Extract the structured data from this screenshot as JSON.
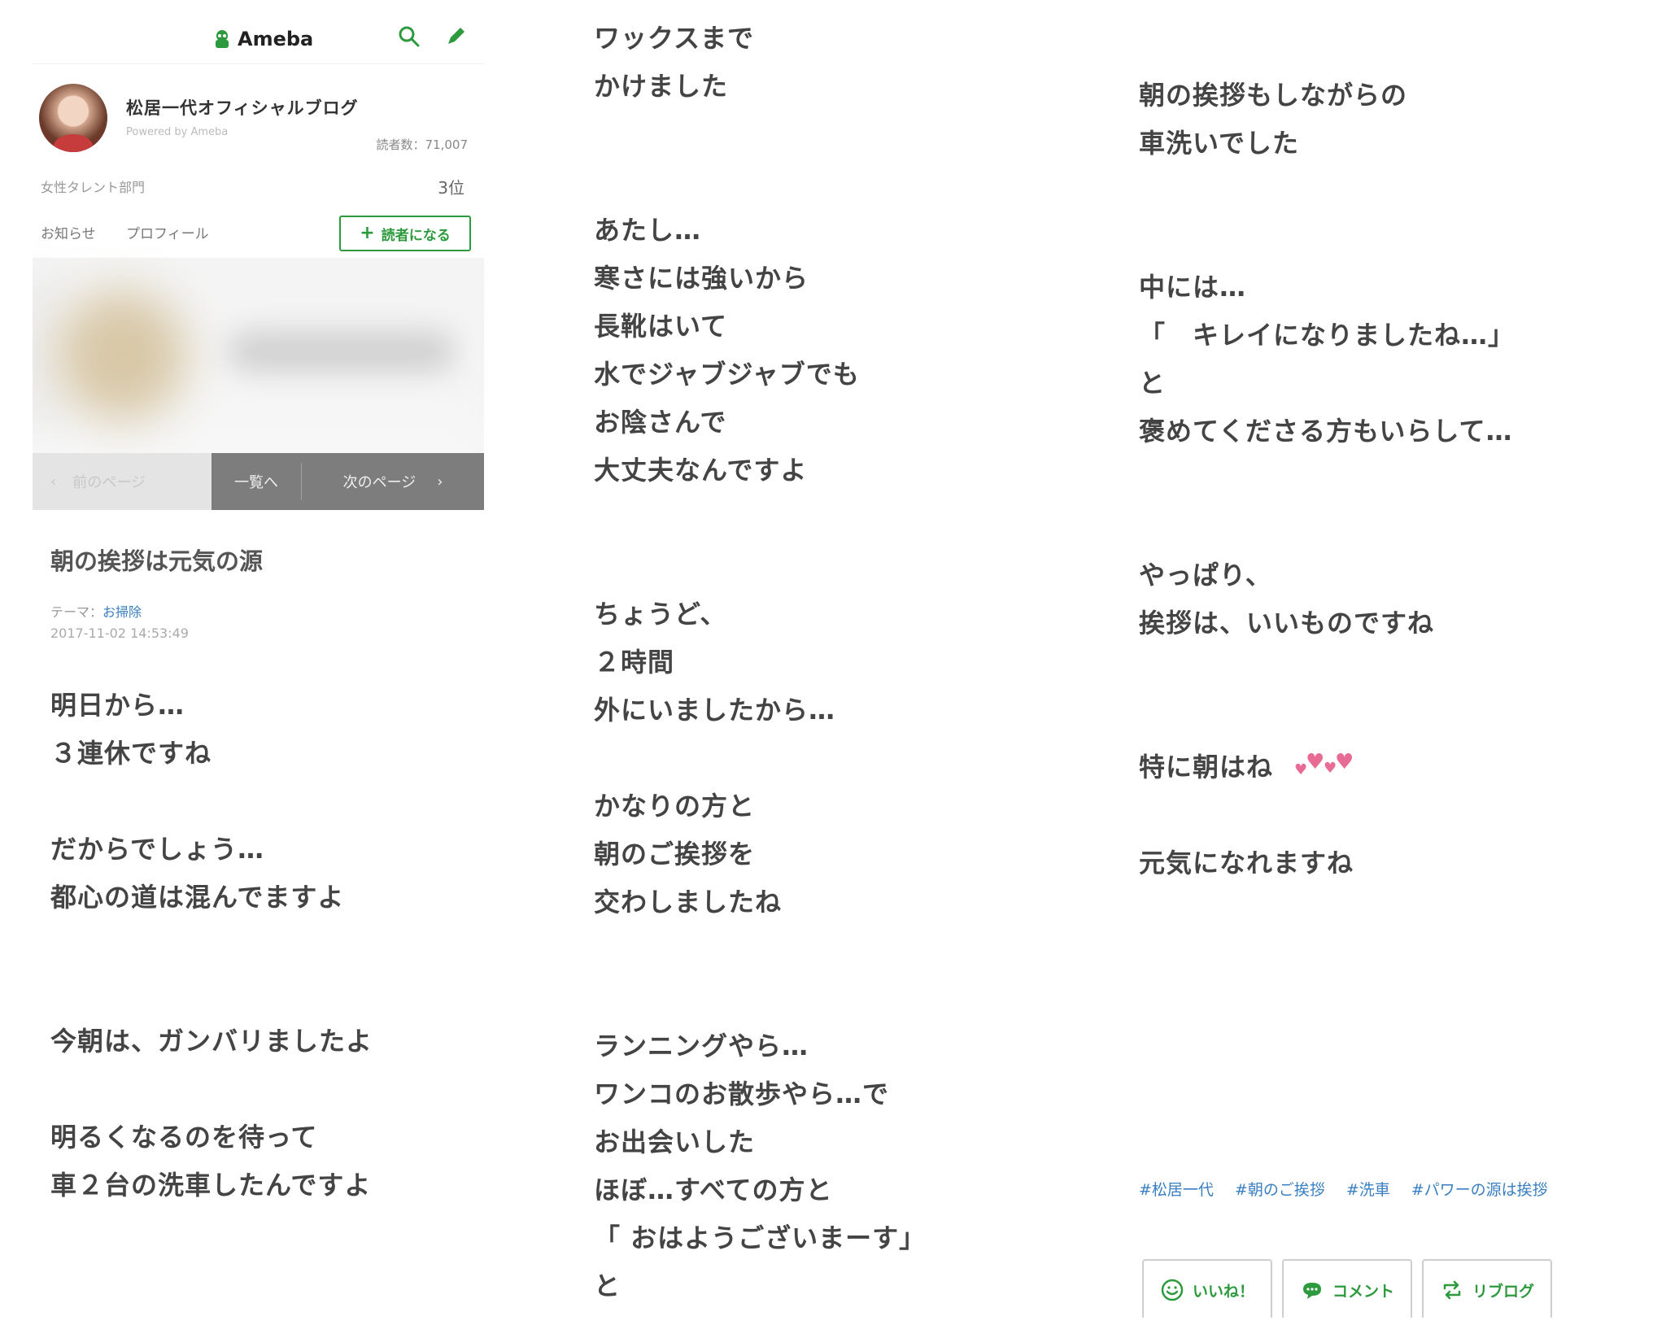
{
  "header": {
    "logo_text": "Ameba",
    "search_icon": "search-icon",
    "edit_icon": "pen-icon",
    "accent": "#2d9a3e"
  },
  "profile": {
    "blog_name": "松居一代オフィシャルブログ",
    "powered": "Powered by Ameba",
    "readers": "読者数：71,007",
    "category": "女性タレント部門",
    "rank": "3位"
  },
  "nav": {
    "news": "お知らせ",
    "profile": "プロフィール",
    "follow": "読者になる"
  },
  "pager": {
    "prev": "前のページ",
    "list": "一覧へ",
    "next": "次のページ"
  },
  "post": {
    "title": "朝の挨拶は元気の源",
    "theme_label": "テーマ：",
    "theme": "お掃除",
    "date": "2017-11-02 14:53:49"
  },
  "body": {
    "col1": [
      "明日から…",
      "３連休ですね",
      "",
      "だからでしょう…",
      "都心の道は混んでますよ",
      "",
      "",
      "今朝は、ガンバリましたよ",
      "",
      "明るくなるのを待って",
      "車２台の洗車したんですよ"
    ],
    "col2": [
      "ワックスまで",
      "かけました",
      "",
      "",
      "あたし…",
      "寒さには強いから",
      "長靴はいて",
      "水でジャブジャブでも",
      "お陰さんで",
      "大丈夫なんですよ",
      "",
      "",
      "ちょうど、",
      "２時間",
      "外にいましたから…",
      "",
      "かなりの方と",
      "朝のご挨拶を",
      "交わしましたね",
      "",
      "",
      "ランニングやら…",
      "ワンコのお散歩やら…で",
      "お出会いした",
      "ほぼ…すべての方と",
      "「 おはようございまーす」",
      "と"
    ],
    "col3": [
      "朝の挨拶もしながらの",
      "車洗いでした",
      "",
      "",
      "中には…",
      "「　キレイになりましたね…」",
      "と",
      "褒めてくださる方もいらして…",
      "",
      "",
      "やっぱり、",
      "挨拶は、いいものですね",
      "",
      "",
      "特に朝はね",
      "",
      "元気になれますね"
    ],
    "hearts_icon": "hearts-icon",
    "heart_color": "#e86b93"
  },
  "hashtags": [
    "#松居一代",
    "#朝のご挨拶",
    "#洗車",
    "#パワーの源は挨拶"
  ],
  "actions": {
    "like": "いいね！",
    "comment": "コメント",
    "reblog": "リブログ"
  }
}
